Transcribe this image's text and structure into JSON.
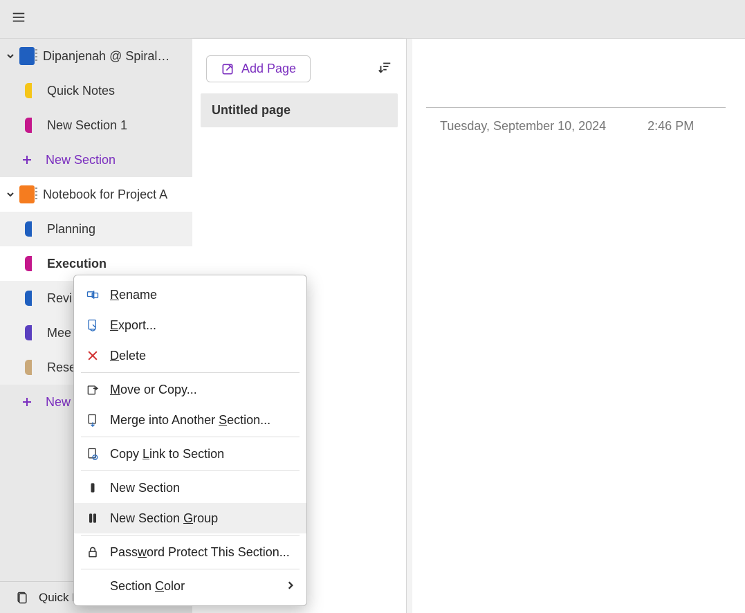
{
  "notebooks": [
    {
      "name": "Dipanjenah @ Spiral…",
      "color": "blue",
      "sections": [
        {
          "label": "Quick Notes",
          "color": "#f5c518"
        },
        {
          "label": "New Section 1",
          "color": "#c4178b"
        }
      ],
      "new_section_label": "New Section"
    },
    {
      "name": "Notebook for Project A",
      "color": "orange",
      "selected": true,
      "sections": [
        {
          "label": "Planning",
          "color": "#1f5fbf"
        },
        {
          "label": "Execution",
          "color": "#c4178b",
          "selected": true
        },
        {
          "label": "Revi",
          "color": "#1f5fbf"
        },
        {
          "label": "Mee",
          "color": "#5a3fbf"
        },
        {
          "label": "Rese",
          "color": "#caa97a"
        }
      ],
      "new_section_label": "New"
    }
  ],
  "sidebar_footer": "Quick Notes",
  "pages": {
    "add_page_label": "Add Page",
    "items": [
      {
        "title": "Untitled page",
        "selected": true
      }
    ]
  },
  "note": {
    "date": "Tuesday, September 10, 2024",
    "time": "2:46 PM"
  },
  "context_menu": {
    "rename": "Rename",
    "export": "Export...",
    "delete": "Delete",
    "move_copy": "Move or Copy...",
    "merge": "Merge into Another Section...",
    "copy_link": "Copy Link to Section",
    "new_section": "New Section",
    "new_section_group": "New Section Group",
    "password": "Password Protect This Section...",
    "color": "Section Color"
  }
}
